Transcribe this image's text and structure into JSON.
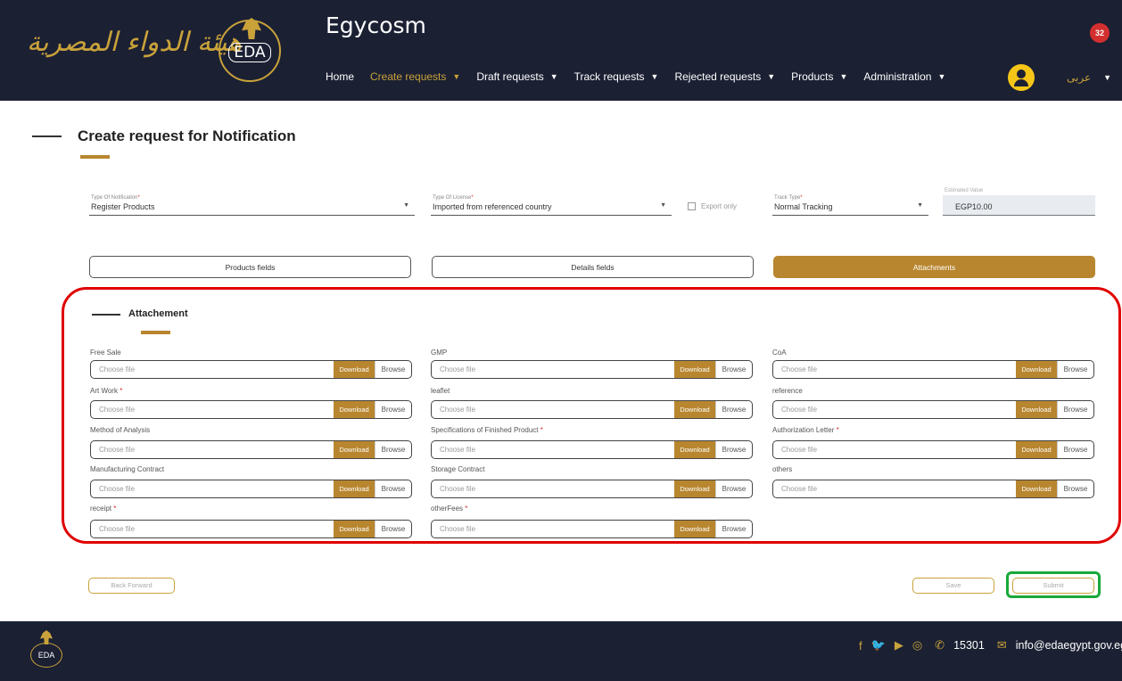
{
  "header": {
    "logo_arabic": "هيئة الدواء المصرية",
    "emblem_text": "EDA",
    "app_title": "Egycosm",
    "notification_count": "32",
    "language_label": "عربى",
    "nav": [
      {
        "label": "Home",
        "active": false,
        "has_dropdown": false
      },
      {
        "label": "Create requests",
        "active": true,
        "has_dropdown": true
      },
      {
        "label": "Draft requests",
        "active": false,
        "has_dropdown": true
      },
      {
        "label": "Track requests",
        "active": false,
        "has_dropdown": true
      },
      {
        "label": "Rejected requests",
        "active": false,
        "has_dropdown": true
      },
      {
        "label": "Products",
        "active": false,
        "has_dropdown": true
      },
      {
        "label": "Administration",
        "active": false,
        "has_dropdown": true
      }
    ]
  },
  "page": {
    "title": "Create request for Notification"
  },
  "form": {
    "type_of_notification": {
      "label": "Type Of Notification",
      "value": "Register Products"
    },
    "type_of_license": {
      "label": "Type Of License",
      "value": "Imported from referenced country"
    },
    "export_only": {
      "label": "Export only",
      "checked": false
    },
    "track_type": {
      "label": "Track Type",
      "value": "Normal Tracking"
    },
    "estimated_value": {
      "label": "Estimated Value",
      "value": "EGP10.00"
    }
  },
  "tabs": {
    "products": "Products fields",
    "details": "Details fields",
    "attachments": "Attachments"
  },
  "attachments": {
    "title": "Attachement",
    "placeholder": "Choose file",
    "download": "Download",
    "browse": "Browse",
    "fields": [
      {
        "label": "Free Sale",
        "required": false
      },
      {
        "label": "GMP",
        "required": false
      },
      {
        "label": "CoA",
        "required": false
      },
      {
        "label": "Art Work",
        "required": true
      },
      {
        "label": "leaflet",
        "required": false
      },
      {
        "label": "reference",
        "required": false
      },
      {
        "label": "Method of Analysis",
        "required": false
      },
      {
        "label": "Specifications of Finished Product",
        "required": true
      },
      {
        "label": "Authorization Letter",
        "required": true
      },
      {
        "label": "Manufacturing Contract",
        "required": false
      },
      {
        "label": "Storage Contract",
        "required": false
      },
      {
        "label": "others",
        "required": false
      },
      {
        "label": "receipt",
        "required": true
      },
      {
        "label": "otherFees",
        "required": true
      }
    ]
  },
  "buttons": {
    "back_forward": "Back Forward",
    "save": "Save",
    "submit": "Submit"
  },
  "footer": {
    "emblem_text": "EDA",
    "hotline": "15301",
    "email": "info@edaegypt.gov.eg"
  },
  "colors": {
    "header_bg": "#1b2033",
    "accent_gold": "#b8862f",
    "required_red": "#d32f2f",
    "highlight_red": "#e00000",
    "highlight_green": "#1aa83a"
  }
}
